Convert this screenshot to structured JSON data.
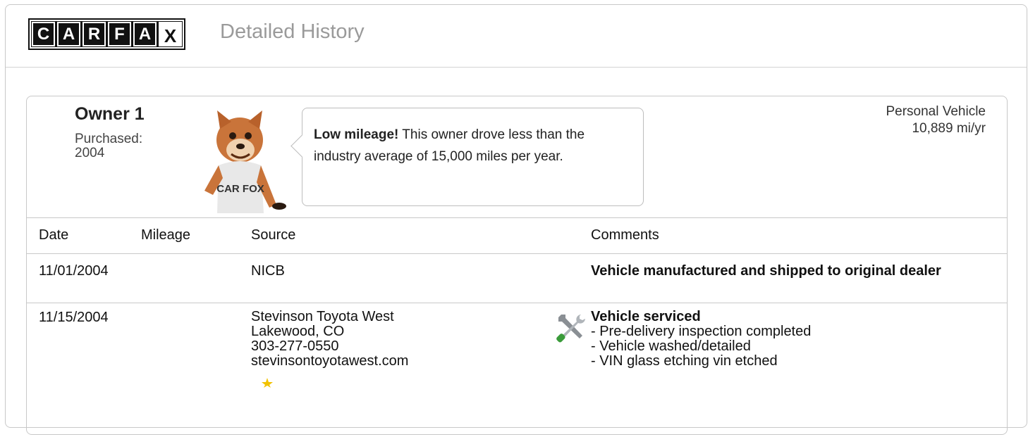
{
  "header": {
    "logo_letters": [
      "C",
      "A",
      "R",
      "F",
      "A",
      "X"
    ],
    "title": "Detailed History"
  },
  "owner": {
    "name": "Owner 1",
    "purchased_label": "Purchased:",
    "purchased_year": "2004",
    "fox_shirt": "CAR FOX",
    "callout_bold": "Low mileage!",
    "callout_text": " This owner drove less than the industry average of 15,000 miles per year.",
    "vehicle_type": "Personal Vehicle",
    "mileage_per_year": "10,889 mi/yr"
  },
  "table": {
    "headers": {
      "date": "Date",
      "mileage": "Mileage",
      "source": "Source",
      "comments": "Comments"
    },
    "rows": [
      {
        "date": "11/01/2004",
        "mileage": "",
        "source": [
          "NICB"
        ],
        "comment_title": "Vehicle manufactured and shipped to original dealer",
        "comment_lines": []
      },
      {
        "date": "11/15/2004",
        "mileage": "",
        "source": [
          "Stevinson Toyota West",
          "Lakewood, CO",
          "303-277-0550",
          "stevinsontoyotawest.com"
        ],
        "comment_title": "Vehicle serviced",
        "comment_lines": [
          "- Pre-delivery inspection completed",
          "- Vehicle washed/detailed",
          "- VIN glass etching vin etched"
        ]
      }
    ]
  },
  "icons": {
    "service": "wrench-screwdriver-icon"
  },
  "colors": {
    "title_gray": "#9a9a9a",
    "border": "#c8c8c8",
    "logo_black": "#111111",
    "fox_orange": "#c9743a"
  }
}
